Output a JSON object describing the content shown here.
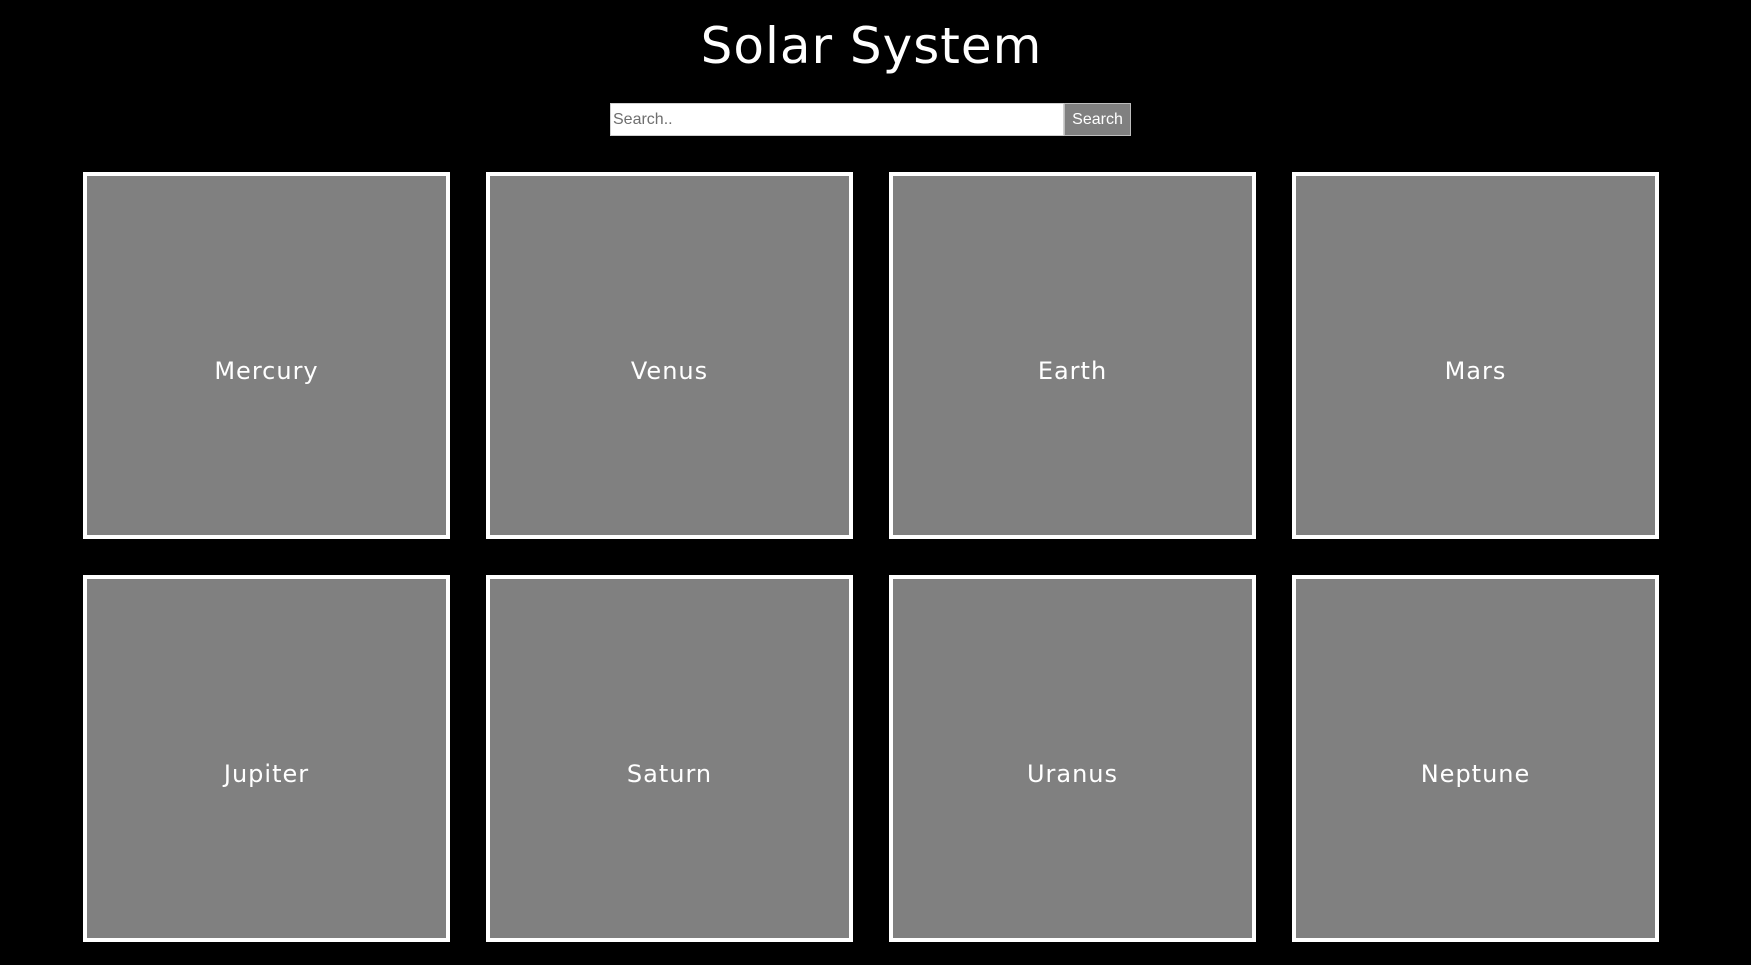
{
  "header": {
    "title": "Solar System"
  },
  "search": {
    "placeholder": "Search..",
    "value": "",
    "button_label": "Search"
  },
  "planets": [
    {
      "label": "Mercury"
    },
    {
      "label": "Venus"
    },
    {
      "label": "Earth"
    },
    {
      "label": "Mars"
    },
    {
      "label": "Jupiter"
    },
    {
      "label": "Saturn"
    },
    {
      "label": "Uranus"
    },
    {
      "label": "Neptune"
    }
  ],
  "colors": {
    "background": "#000000",
    "card_fill": "#808080",
    "card_border": "#ffffff",
    "text": "#ffffff",
    "button_fill": "#808080"
  }
}
